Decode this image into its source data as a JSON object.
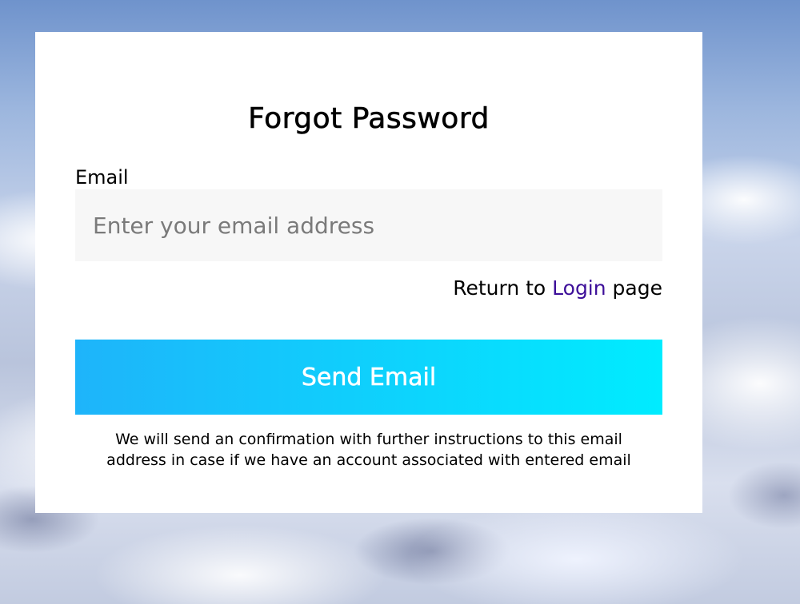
{
  "page": {
    "background": "sky-clouds"
  },
  "form": {
    "title": "Forgot Password",
    "email_label": "Email",
    "email_placeholder": "Enter your email address",
    "email_value": "",
    "return_prefix": "Return to ",
    "return_link": "Login",
    "return_suffix": " page",
    "send_button": "Send Email",
    "note": "We will send an confirmation with further instructions to this email address in case if we have an account associated with entered email"
  },
  "colors": {
    "button_gradient_start": "#1eb4fa",
    "button_gradient_end": "#00ecff",
    "link": "#3d0f99",
    "card_background": "#ffffff"
  }
}
